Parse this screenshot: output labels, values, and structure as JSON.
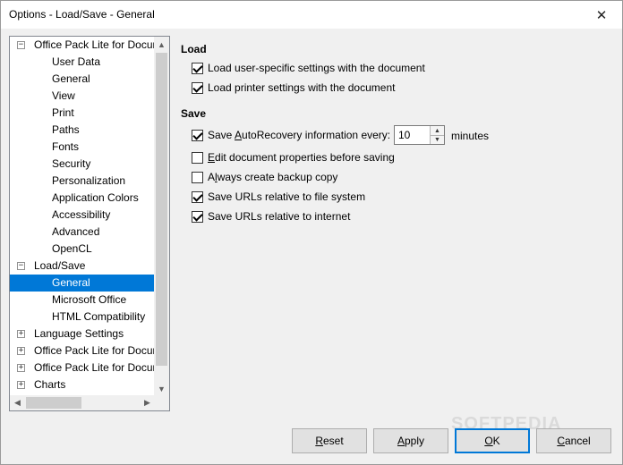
{
  "window": {
    "title": "Options - Load/Save - General"
  },
  "tree": {
    "nodes": [
      {
        "label": "Office Pack Lite for Docur",
        "level": 0,
        "expander": "minus"
      },
      {
        "label": "User Data",
        "level": 1
      },
      {
        "label": "General",
        "level": 1
      },
      {
        "label": "View",
        "level": 1
      },
      {
        "label": "Print",
        "level": 1
      },
      {
        "label": "Paths",
        "level": 1
      },
      {
        "label": "Fonts",
        "level": 1
      },
      {
        "label": "Security",
        "level": 1
      },
      {
        "label": "Personalization",
        "level": 1
      },
      {
        "label": "Application Colors",
        "level": 1
      },
      {
        "label": "Accessibility",
        "level": 1
      },
      {
        "label": "Advanced",
        "level": 1
      },
      {
        "label": "OpenCL",
        "level": 1
      },
      {
        "label": "Load/Save",
        "level": 0,
        "expander": "minus"
      },
      {
        "label": "General",
        "level": 1,
        "selected": true
      },
      {
        "label": "Microsoft Office",
        "level": 1
      },
      {
        "label": "HTML Compatibility",
        "level": 1
      },
      {
        "label": "Language Settings",
        "level": 0,
        "expander": "plus"
      },
      {
        "label": "Office Pack Lite for Docur",
        "level": 0,
        "expander": "plus"
      },
      {
        "label": "Office Pack Lite for Docur",
        "level": 0,
        "expander": "plus"
      },
      {
        "label": "Charts",
        "level": 0,
        "expander": "plus"
      }
    ]
  },
  "load": {
    "title": "Load",
    "user_settings": {
      "label": "Load user-specific settings with the document",
      "checked": true
    },
    "printer_settings": {
      "label": "Load printer settings with the document",
      "checked": true
    }
  },
  "save": {
    "title": "Save",
    "autorecovery": {
      "pre": "Save ",
      "accel": "A",
      "post": "utoRecovery information every:",
      "checked": true
    },
    "autorecovery_value": "10",
    "autorecovery_unit": "minutes",
    "edit_props": {
      "pre": "",
      "accel": "E",
      "post": "dit document properties before saving",
      "checked": false
    },
    "backup": {
      "pre": "A",
      "accel": "l",
      "post": "ways create backup copy",
      "checked": false
    },
    "urls_fs": {
      "label": "Save URLs relative to file system",
      "checked": true
    },
    "urls_inet": {
      "label": "Save URLs relative to internet",
      "checked": true
    }
  },
  "buttons": {
    "reset": {
      "pre": "",
      "accel": "R",
      "post": "eset"
    },
    "apply": {
      "pre": "",
      "accel": "A",
      "post": "pply"
    },
    "ok": {
      "pre": "",
      "accel": "O",
      "post": "K"
    },
    "cancel": {
      "pre": "",
      "accel": "C",
      "post": "ancel"
    }
  },
  "watermark": "SOFTPEDIA",
  "colors": {
    "selection": "#0078d7",
    "default_button_border": "#0078d7"
  }
}
